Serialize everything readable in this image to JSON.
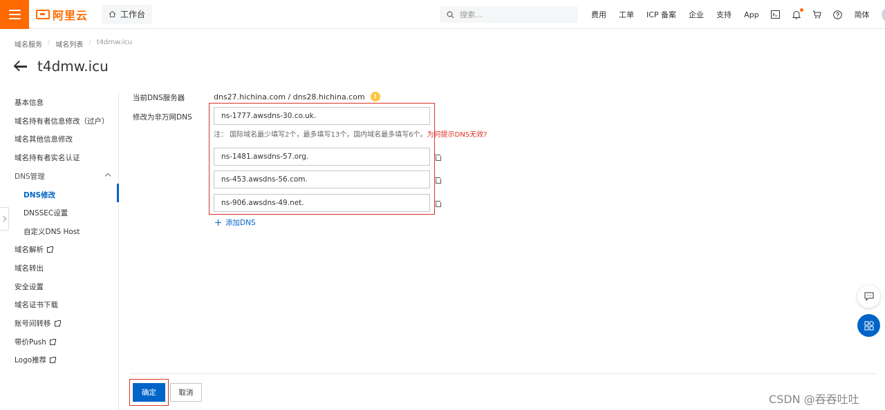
{
  "topbar": {
    "logo_text": "阿里云",
    "workbench_label": "工作台",
    "search_placeholder": "搜索...",
    "nav_links": [
      "费用",
      "工单",
      "ICP 备案",
      "企业",
      "支持",
      "App"
    ],
    "lang_label": "简体",
    "accent_color": "#ff6a00"
  },
  "breadcrumb": [
    "域名服务",
    "域名列表",
    "t4dmw.icu"
  ],
  "page_title": "t4dmw.icu",
  "leftnav": {
    "items": [
      {
        "label": "基本信息"
      },
      {
        "label": "域名持有者信息修改（过户）"
      },
      {
        "label": "域名其他信息修改"
      },
      {
        "label": "域名持有者实名认证"
      },
      {
        "label": "DNS管理"
      },
      {
        "label": "DNS修改"
      },
      {
        "label": "DNSSEC设置"
      },
      {
        "label": "自定义DNS Host"
      },
      {
        "label": "域名解析"
      },
      {
        "label": "域名转出"
      },
      {
        "label": "安全设置"
      },
      {
        "label": "域名证书下载"
      },
      {
        "label": "账号间转移"
      },
      {
        "label": "带价Push"
      },
      {
        "label": "Logo推荐"
      }
    ],
    "active_color": "#0064c8"
  },
  "form": {
    "current_dns_label": "当前DNS服务器",
    "current_dns_value": "dns27.hichina.com / dns28.hichina.com",
    "modify_label": "修改为非万网DNS",
    "dns_inputs": [
      "ns-1777.awsdns-30.co.uk.",
      "ns-1481.awsdns-57.org.",
      "ns-453.awsdns-56.com.",
      "ns-906.awsdns-49.net."
    ],
    "note_text": "注：  国际域名最少填写2个，最多填写13个，国内域名最多填写6个。",
    "note_link": "为何提示DNS无效?",
    "add_dns_label": "添加DNS",
    "confirm_label": "确定",
    "cancel_label": "取消"
  },
  "watermark": "CSDN @吞吞吐吐",
  "highlight_color": "#d93026"
}
